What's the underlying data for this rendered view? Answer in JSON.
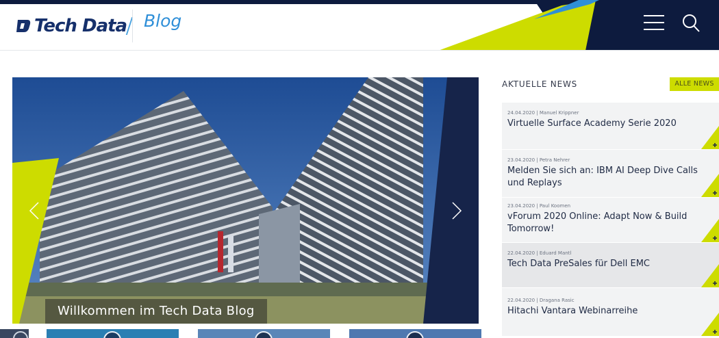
{
  "header": {
    "logo_text": "Tech Data",
    "section_label": "Blog",
    "menu_icon": "hamburger-icon",
    "search_icon": "search-icon"
  },
  "hero": {
    "caption": "Willkommen im Tech Data Blog",
    "prev_icon": "chevron-left-icon",
    "next_icon": "chevron-right-icon"
  },
  "news": {
    "title": "AKTUELLE NEWS",
    "all_button": "ALLE NEWS",
    "items": [
      {
        "meta": "24.04.2020 | Manuel Krippner",
        "headline": "Virtuelle Surface Academy Serie 2020"
      },
      {
        "meta": "23.04.2020 | Petra Nehrer",
        "headline": "Melden Sie sich an: IBM AI Deep Dive Calls und Replays"
      },
      {
        "meta": "23.04.2020 | Paul Koomen",
        "headline": "vForum 2020 Online: Adapt Now & Build Tomorrow!"
      },
      {
        "meta": "22.04.2020 | Eduard Mantl",
        "headline": "Tech Data PreSales für Dell EMC"
      },
      {
        "meta": "22.04.2020 | Dragana Rasic",
        "headline": "Hitachi Vantara Webinarreihe"
      }
    ]
  },
  "colors": {
    "navy": "#0d1b3e",
    "lime": "#cddc00",
    "blue": "#2f8fd8"
  }
}
